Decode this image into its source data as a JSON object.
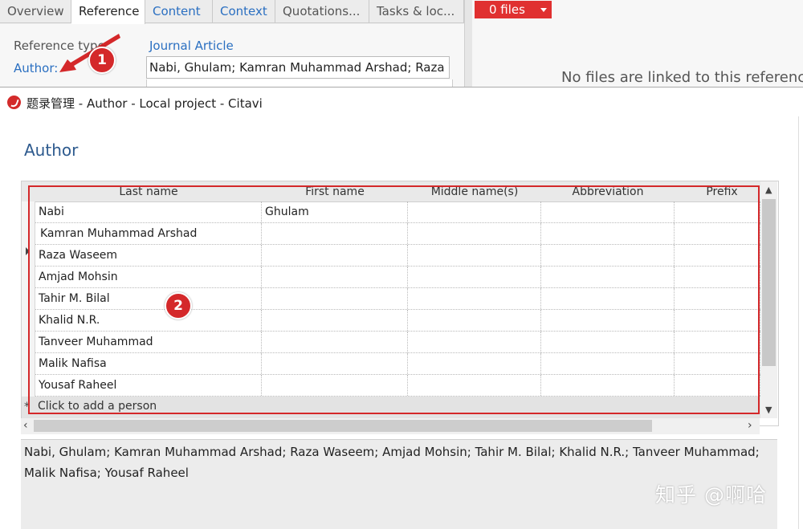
{
  "tabs": [
    "Overview",
    "Reference",
    "Content",
    "Context",
    "Quotations...",
    "Tasks & loc..."
  ],
  "reference_pane": {
    "reference_type_label": "Reference type:",
    "reference_type_value": "Journal Article",
    "author_label": "Author:",
    "author_value": "Nabi, Ghulam; Kamran Muhammad Arshad; Raza Wa"
  },
  "files": {
    "button_label": "0 files",
    "empty_message": "No files are linked to this reference."
  },
  "annotations": {
    "first": "1",
    "second": "2"
  },
  "dialog": {
    "title": "题录管理 - Author - Local project - Citavi",
    "heading": "Author"
  },
  "grid": {
    "columns": [
      "Last name",
      "First name",
      "Middle name(s)",
      "Abbreviation",
      "Prefix"
    ],
    "rows": [
      [
        "Nabi",
        "Ghulam",
        "",
        "",
        ""
      ],
      [
        "Kamran Muhammad Arshad",
        "",
        "",
        "",
        ""
      ],
      [
        "Raza Waseem",
        "",
        "",
        "",
        ""
      ],
      [
        "Amjad Mohsin",
        "",
        "",
        "",
        ""
      ],
      [
        "Tahir M. Bilal",
        "",
        "",
        "",
        ""
      ],
      [
        "Khalid N.R.",
        "",
        "",
        "",
        ""
      ],
      [
        "Tanveer Muhammad",
        "",
        "",
        "",
        ""
      ],
      [
        "Malik Nafisa",
        "",
        "",
        "",
        ""
      ],
      [
        "Yousaf Raheel",
        "",
        "",
        "",
        ""
      ]
    ],
    "add_placeholder": "Click to add a person",
    "add_symbol": "*"
  },
  "summary_text": "Nabi, Ghulam; Kamran Muhammad Arshad; Raza Waseem; Amjad Mohsin; Tahir M. Bilal; Khalid N.R.; Tanveer Muhammad; Malik Nafisa; Yousaf Raheel",
  "watermark": "知乎 @啊哈",
  "colors": {
    "accent_red": "#d4282a",
    "link_blue": "#2a6fc1",
    "heading_blue": "#2d5a8e"
  }
}
